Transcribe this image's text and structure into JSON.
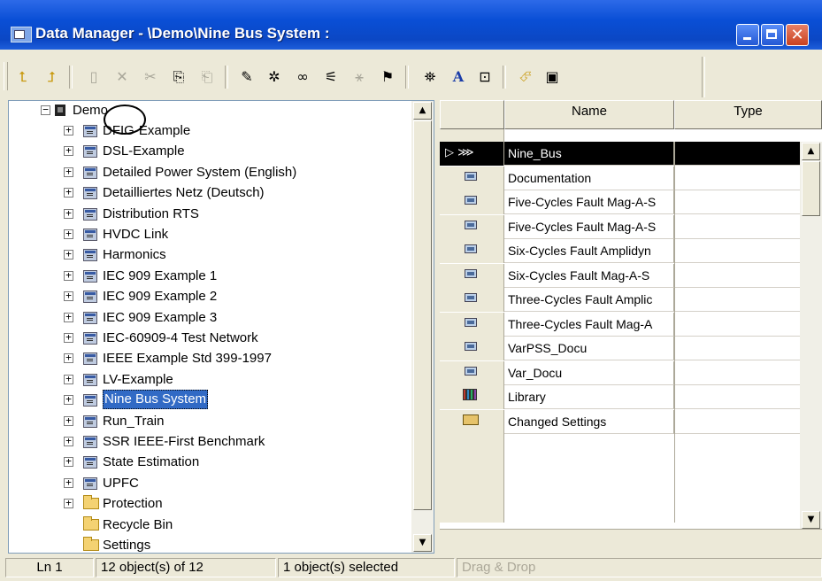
{
  "window": {
    "title": "Data Manager - \\Demo\\Nine Bus System :",
    "close_glyph": "✕"
  },
  "toolbar": {
    "icons": [
      "folder-up-icon",
      "folder-open-icon",
      "new-object-icon",
      "delete-icon",
      "cut-icon",
      "copy-icon",
      "paste-icon",
      "edit-icon",
      "settings-icon",
      "glasses-icon",
      "filter-icon",
      "network-icon",
      "mark-icon",
      "find-icon",
      "font-icon",
      "edit-doc-icon",
      "open-icon",
      "save-icon"
    ],
    "glyphs": {
      "folder_up": "⮤",
      "folder_open": "⮥",
      "new_object": "▯",
      "delete": "✕",
      "cut": "✂",
      "copy": "⎘",
      "paste": "⎗",
      "edit": "✎",
      "settings": "✲",
      "glasses": "∞",
      "filter": "⚟",
      "network": "⚹",
      "mark": "⚑",
      "find": "⛯",
      "font": "A",
      "edit_doc": "⊡",
      "open": "⮶",
      "save": "▣"
    }
  },
  "tree": {
    "root": {
      "label": "Demo",
      "expander": "−"
    },
    "items": [
      {
        "label": "DFIG-Example",
        "expander": "+",
        "icon": "project-icon"
      },
      {
        "label": "DSL-Example",
        "expander": "+",
        "icon": "project-icon"
      },
      {
        "label": "Detailed Power System (English)",
        "expander": "+",
        "icon": "project-icon"
      },
      {
        "label": "Detailliertes Netz (Deutsch)",
        "expander": "+",
        "icon": "project-icon"
      },
      {
        "label": "Distribution RTS",
        "expander": "+",
        "icon": "project-icon"
      },
      {
        "label": "HVDC Link",
        "expander": "+",
        "icon": "project-icon"
      },
      {
        "label": "Harmonics",
        "expander": "+",
        "icon": "project-icon"
      },
      {
        "label": "IEC 909 Example 1",
        "expander": "+",
        "icon": "project-icon"
      },
      {
        "label": "IEC 909 Example 2",
        "expander": "+",
        "icon": "project-icon"
      },
      {
        "label": "IEC 909 Example 3",
        "expander": "+",
        "icon": "project-icon"
      },
      {
        "label": "IEC-60909-4 Test Network",
        "expander": "+",
        "icon": "project-icon"
      },
      {
        "label": "IEEE Example Std 399-1997",
        "expander": "+",
        "icon": "project-icon"
      },
      {
        "label": "LV-Example",
        "expander": "+",
        "icon": "project-icon"
      },
      {
        "label": "Nine Bus System",
        "expander": "+",
        "icon": "project-icon",
        "selected": true
      },
      {
        "label": "Run_Train",
        "expander": "+",
        "icon": "project-icon"
      },
      {
        "label": "SSR IEEE-First Benchmark",
        "expander": "+",
        "icon": "project-icon"
      },
      {
        "label": "State Estimation",
        "expander": "+",
        "icon": "project-icon"
      },
      {
        "label": "UPFC",
        "expander": "+",
        "icon": "project-icon"
      },
      {
        "label": "Protection",
        "expander": "+",
        "icon": "folder-icon"
      },
      {
        "label": "Recycle Bin",
        "expander": "",
        "icon": "folder-icon"
      },
      {
        "label": "Settings",
        "expander": "",
        "icon": "folder-icon"
      }
    ],
    "scroll_up": "▲",
    "scroll_down": "▼"
  },
  "list": {
    "columns": {
      "name": "Name",
      "type": "Type"
    },
    "active_marker": "▷ ⋙",
    "rows": [
      {
        "name": "Nine_Bus",
        "type": "",
        "icon": "grid-icon",
        "active": true
      },
      {
        "name": "Documentation",
        "type": "",
        "icon": "study-case-icon"
      },
      {
        "name": "Five-Cycles Fault Mag-A-S",
        "type": "",
        "icon": "study-case-icon"
      },
      {
        "name": "Five-Cycles Fault Mag-A-S",
        "type": "",
        "icon": "study-case-icon"
      },
      {
        "name": "Six-Cycles Fault Amplidyn",
        "type": "",
        "icon": "study-case-icon"
      },
      {
        "name": "Six-Cycles Fault Mag-A-S",
        "type": "",
        "icon": "study-case-icon"
      },
      {
        "name": "Three-Cycles Fault Amplic",
        "type": "",
        "icon": "study-case-icon"
      },
      {
        "name": "Three-Cycles Fault Mag-A",
        "type": "",
        "icon": "study-case-icon"
      },
      {
        "name": "VarPSS_Docu",
        "type": "",
        "icon": "study-case-icon"
      },
      {
        "name": "Var_Docu",
        "type": "",
        "icon": "study-case-icon"
      },
      {
        "name": "Library",
        "type": "",
        "icon": "library-icon"
      },
      {
        "name": "Changed Settings",
        "type": "",
        "icon": "settings-folder-icon"
      }
    ],
    "scroll_up": "▲",
    "scroll_down": "▼"
  },
  "status": {
    "line": "Ln 1",
    "objects": "12 object(s) of 12",
    "selected": "1 object(s) selected",
    "mode": "Drag & Drop"
  },
  "colors": {
    "titlebar": "#0A4FD6",
    "selection": "#316AC5",
    "face": "#ECE9D8"
  }
}
